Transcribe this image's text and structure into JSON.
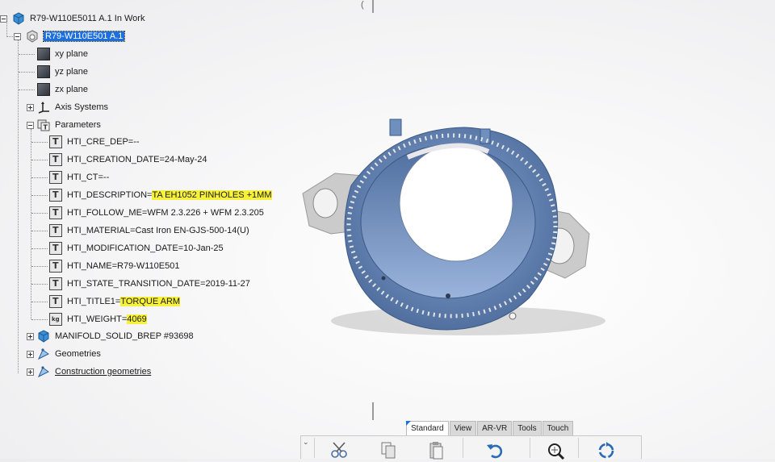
{
  "tree": {
    "root": "R79-W110E5011 A.1 In Work",
    "part": "R79-W110E501 A.1",
    "planes": [
      "xy plane",
      "yz plane",
      "zx plane"
    ],
    "axis_systems": "Axis Systems",
    "parameters_label": "Parameters",
    "parameters": [
      {
        "text": "HTI_CRE_DEP=--"
      },
      {
        "text": "HTI_CREATION_DATE=24-May-24"
      },
      {
        "text": "HTI_CT=--"
      },
      {
        "prefix": "HTI_DESCRIPTION=",
        "value": "TA EH1052 PINHOLES +1MM"
      },
      {
        "text": "HTI_FOLLOW_ME=WFM 2.3.226 + WFM 2.3.205"
      },
      {
        "text": "HTI_MATERIAL=Cast Iron EN-GJS-500-14(U)"
      },
      {
        "text": "HTI_MODIFICATION_DATE=10-Jan-25"
      },
      {
        "text": "HTI_NAME=R79-W110E501"
      },
      {
        "text": "HTI_STATE_TRANSITION_DATE=2019-11-27"
      },
      {
        "prefix": "HTI_TITLE1=",
        "value": "TORQUE ARM"
      },
      {
        "prefix": "HTI_WEIGHT=",
        "value": "4069"
      }
    ],
    "brep": "MANIFOLD_SOLID_BREP #93698",
    "geometries": "Geometries",
    "construction": "Construction geometries"
  },
  "toolbar": {
    "tabs": [
      "Standard",
      "View",
      "AR-VR",
      "Tools",
      "Touch"
    ],
    "active_tab": "Standard",
    "buttons": [
      "cut-icon",
      "copy-icon",
      "paste-icon",
      "undo-icon",
      "zoom-fit-icon",
      "refresh-icon"
    ]
  },
  "colors": {
    "part_blue": "#6f8fbf",
    "flange_gray": "#c9c9c9",
    "highlight_yellow": "#f7f13a",
    "selection_blue": "#1d6fe0"
  }
}
